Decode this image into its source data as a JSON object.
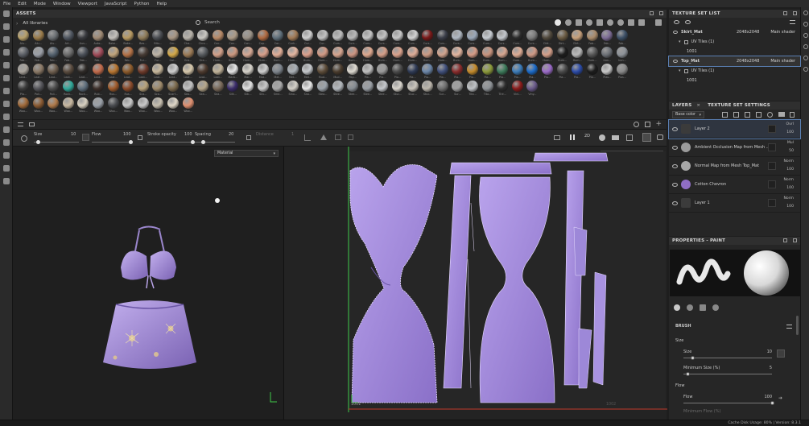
{
  "menubar": {
    "items": [
      "File",
      "Edit",
      "Mode",
      "Window",
      "Viewport",
      "JavaScript",
      "Python",
      "Help"
    ]
  },
  "assets": {
    "title": "ASSETS",
    "library_label": "All libraries",
    "search_placeholder": "Search",
    "swatch_rows": [
      {
        "labels": [
          "Alu...",
          "Alu...",
          "Alu...",
          "Art...",
          "Aus...",
          "Auto...",
          "Bake...",
          "Bake...",
          "Bas...",
          "Bitu...",
          "Cer...",
          "Cha...",
          "Chro...",
          "Coc...",
          "Con...",
          "Con...",
          "Cop...",
          "Cor...",
          "Cork...",
          "Cur...",
          "Cur...",
          "Curs...",
          "Curs...",
          "Curs...",
          "Curs...",
          "Curs...",
          "Curs...",
          "Curs...",
          "Curs...",
          "Curs...",
          "Curs...",
          "Curs...",
          "Curs...",
          "Curs...",
          "Curs...",
          "Dirt...",
          "Dirt...",
          "Dirt...",
          "Fab...",
          "Fab...",
          "Fab..."
        ],
        "colors": [
          "#b7a06a",
          "#9a7b49",
          "#6b6f73",
          "#4f5660",
          "#3a3b3f",
          "#a08a74",
          "#c3c0bb",
          "#b89a61",
          "#8f7c59",
          "#4a4d52",
          "#a79683",
          "#b7b2a9",
          "#c9c7c2",
          "#b88966",
          "#ab9a86",
          "#9a9186",
          "#b06a40",
          "#5f6f7a",
          "#a17a55",
          "#cfcfcf",
          "#c0c0c0",
          "#bdbdbd",
          "#b8b8b8",
          "#c4c4c4",
          "#c2c2c2",
          "#c6c6c6",
          "#d2d2d2",
          "#7a1818",
          "#3a3d48",
          "#b0b8c2",
          "#9aa7b8",
          "#c6cbd1",
          "#c3c7cc",
          "#2b2b2b",
          "#7c7c7c",
          "#51493c",
          "#6a5a42",
          "#c7a07a",
          "#a88a6a",
          "#7c6b95",
          "#3c4f66"
        ]
      },
      {
        "labels": [
          "Fab...",
          "Fab...",
          "Fab...",
          "Fab...",
          "Fab...",
          "Fab...",
          "Fab...",
          "Fab...",
          "Fur...",
          "Fur...",
          "Gol...",
          "Gra...",
          "Gra...",
          "Hum...",
          "Hum...",
          "Hum...",
          "Hum...",
          "Hum...",
          "Hum...",
          "Hum...",
          "Hum...",
          "Hum...",
          "Hum...",
          "Hum...",
          "Hum...",
          "Hum...",
          "Hum...",
          "Hum...",
          "Hum...",
          "Hum...",
          "Hum...",
          "Hum...",
          "Hum...",
          "Hum...",
          "Hum...",
          "Hum...",
          "Hum...",
          "Hum...",
          "Hum...",
          "Iron...",
          "Iron..."
        ],
        "colors": [
          "#5b5f66",
          "#9a9ea6",
          "#54616e",
          "#6b6b6b",
          "#4b5058",
          "#a04a58",
          "#c1a57c",
          "#b57246",
          "#473c35",
          "#bfb5a6",
          "#d4a948",
          "#9b7a55",
          "#565a5e",
          "#d3a089",
          "#cc987f",
          "#d6a894",
          "#d9a08b",
          "#e1ad96",
          "#e5b7a1",
          "#dca08c",
          "#d29a85",
          "#d8a58f",
          "#cd9582",
          "#e0a98f",
          "#d49e88",
          "#dba28c",
          "#e0ae98",
          "#cc9b84",
          "#d2a48e",
          "#e3b59f",
          "#d69c86",
          "#c8937d",
          "#d7a690",
          "#dfac94",
          "#cf9a86",
          "#d59f89",
          "#1c1c1c",
          "#b9b9b9",
          "#575757",
          "#6c7076",
          "#8e9399"
        ]
      },
      {
        "labels": [
          "Leat...",
          "Leat...",
          "Leat...",
          "Leat...",
          "Leat...",
          "Leat...",
          "Leat...",
          "Leat...",
          "Leat...",
          "Leat...",
          "Leat...",
          "Leat...",
          "Leat...",
          "Leat...",
          "Marb...",
          "Mar...",
          "Mat...",
          "Met...",
          "Met...",
          "Met...",
          "Mud...",
          "Mud...",
          "Pap...",
          "Pla...",
          "Pla...",
          "Pla...",
          "Pla...",
          "Pla...",
          "Pla...",
          "Pla...",
          "Pla...",
          "Pla...",
          "Pla...",
          "Pla...",
          "Pla...",
          "Pla...",
          "Pla...",
          "Pla...",
          "Pla...",
          "Plas...",
          "Plas..."
        ],
        "colors": [
          "#a9a39b",
          "#8a7865",
          "#6f5f4f",
          "#5a4b3e",
          "#2e2a27",
          "#c26a4a",
          "#b8752f",
          "#8c5a2a",
          "#6e3a2a",
          "#c8b89c",
          "#cfcfcf",
          "#d8c9ac",
          "#4d3a2e",
          "#c2b49a",
          "#e6e6e6",
          "#d8d4cc",
          "#cfcfcf",
          "#7d848c",
          "#aab0b6",
          "#c6c9cd",
          "#5c4b38",
          "#4a3c2d",
          "#dfdbd2",
          "#c0c0c0",
          "#9a9a9a",
          "#4b4b4b",
          "#2e3a55",
          "#6a85a8",
          "#3f4e7a",
          "#8a2b2b",
          "#c48a2a",
          "#8c9a3a",
          "#3c7a5a",
          "#3a7ab8",
          "#1a6ac8",
          "#9a6ac8",
          "#4a4a4a",
          "#2a4aa8",
          "#1c1c1c",
          "#c8c8c8",
          "#8a8a8a"
        ]
      },
      {
        "labels": [
          "Pla...",
          "Poli...",
          "Poli...",
          "Rock...",
          "Rock...",
          "Rub...",
          "Rus...",
          "Rus...",
          "Sca...",
          "Sca...",
          "Scarf...",
          "Sea...",
          "Sea...",
          "Sea...",
          "Silk...",
          "Silk...",
          "Silv...",
          "Sme...",
          "Smo...",
          "Sno...",
          "Stea...",
          "Stee...",
          "Stee...",
          "Stee...",
          "Stee...",
          "Stuc...",
          "Stuc...",
          "Stuc...",
          "Sur...",
          "Sur...",
          "Tita...",
          "Tita...",
          "Tire...",
          "Vinl...",
          "Viny..."
        ],
        "colors": [
          "#3c3c3c",
          "#55555a",
          "#4d4d4d",
          "#2fa89a",
          "#5e6e7c",
          "#3c2f2a",
          "#a05a2a",
          "#8a4a2a",
          "#b8a27a",
          "#9e8a6a",
          "#7c6a4c",
          "#c2c2c2",
          "#b5a68a",
          "#7a6a5a",
          "#3a2c6a",
          "#e2e2e2",
          "#c9c9c9",
          "#a8a8a8",
          "#d4d0c8",
          "#e8e8e8",
          "#9ca3aa",
          "#b4b9be",
          "#868c92",
          "#9a9fa5",
          "#c5c8cc",
          "#d8d4cc",
          "#cac5bc",
          "#bdb7ad",
          "#6e6e6e",
          "#a0a0a0",
          "#bfc2c5",
          "#8e9296",
          "#2d2d2d",
          "#8a1a1a",
          "#6a5a8a"
        ]
      },
      {
        "labels": [
          "Woo...",
          "Woo...",
          "Woo...",
          "Woo...",
          "Woo...",
          "Woo...",
          "Woo...",
          "Woo...",
          "Woo...",
          "Woo...",
          "Woo...",
          "Woo..."
        ],
        "colors": [
          "#a06a3a",
          "#8a5a32",
          "#b07a4a",
          "#c8b8a0",
          "#d8d0c0",
          "#9aa0a8",
          "#4a4c50",
          "#c8c8c8",
          "#c8c8c8",
          "#c8c0b0",
          "#e0d8c8",
          "#e09070"
        ]
      }
    ]
  },
  "toolbar": {
    "size_label": "Size",
    "size_value": "10",
    "flow_label": "Flow",
    "flow_value": "100",
    "opacity_label": "Stroke opacity",
    "opacity_value": "100",
    "spacing_label": "Spacing",
    "spacing_value": "20",
    "distance_label": "Distance",
    "distance_value": "1",
    "size_fraction": 0.1,
    "flow_fraction": 1.0,
    "opacity_fraction": 1.0,
    "spacing_fraction": 0.2
  },
  "viewport3d": {
    "mode": "Material"
  },
  "viewport2d": {
    "mode": "Material",
    "tile_label": "1001",
    "tile_label_2": "1002"
  },
  "texture_set_list": {
    "title": "TEXTURE SET LIST",
    "sets": [
      {
        "name": "Skirt_Mat",
        "resolution": "2048x2048",
        "shader": "Main shader",
        "uv_label": "UV Tiles (1)",
        "tile": "1001",
        "selected": false
      },
      {
        "name": "Top_Mat",
        "resolution": "2048x2048",
        "shader": "Main shader",
        "uv_label": "UV Tiles (1)",
        "tile": "1001",
        "selected": true
      }
    ]
  },
  "layers_panel": {
    "tab_layers": "LAYERS",
    "tab_settings": "TEXTURE SET SETTINGS",
    "channel": "Base color",
    "layers": [
      {
        "name": "Layer 2",
        "blend": "Ovrl",
        "opacity": "100",
        "thumb": "#3b3b3b",
        "selected": true
      },
      {
        "name": "Ambient Occlusion Map from Mesh ...",
        "blend": "Mul",
        "opacity": "50",
        "thumb": "#9b9b9b",
        "selected": false
      },
      {
        "name": "Normal Map from Mesh Top_Mat",
        "blend": "Norm",
        "opacity": "100",
        "thumb": "#a7a7a7",
        "selected": false
      },
      {
        "name": "Cotton Chevron",
        "blend": "Norm",
        "opacity": "100",
        "thumb": "#8f6ec4",
        "selected": false
      },
      {
        "name": "Layer 1",
        "blend": "Norm",
        "opacity": "100",
        "thumb": "#3b3b3b",
        "selected": false
      }
    ]
  },
  "properties": {
    "title": "PROPERTIES - PAINT",
    "section": "BRUSH",
    "size_group": "Size",
    "size_label": "Size",
    "size_value": "10",
    "size_fraction": 0.1,
    "min_size_label": "Minimum Size (%)",
    "min_size_value": "5",
    "min_size_fraction": 0.05,
    "flow_group": "Flow",
    "flow_label": "Flow",
    "flow_value": "100",
    "flow_fraction": 1.0,
    "min_flow_label": "Minimum Flow (%)"
  },
  "status": {
    "cache": "Cache Disk Usage:  80%  |  Version: 8.3.1"
  },
  "colors": {
    "accent": "#5a7fb2",
    "fabric": "#9c84cf"
  }
}
